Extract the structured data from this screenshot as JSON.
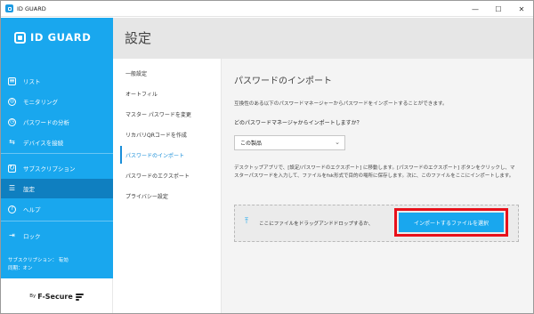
{
  "window": {
    "title": "ID GUARD",
    "controls": [
      "—",
      "☐",
      "✕"
    ]
  },
  "brand": {
    "name": "ID GUARD",
    "footer_by": "By",
    "footer_brand": "F-Secure"
  },
  "colors": {
    "sidebar": "#19a7ee",
    "sidebar_active": "#0f7fc0",
    "accent": "#1a8fd9",
    "highlight_box": "#e8101a"
  },
  "sidebar": {
    "items": [
      {
        "label": "リスト",
        "icon": "list-icon"
      },
      {
        "label": "モニタリング",
        "icon": "monitoring-icon"
      },
      {
        "label": "パスワードの分析",
        "icon": "clock-icon"
      },
      {
        "label": "デバイスを接続",
        "icon": "connect-device-icon"
      },
      {
        "label": "サブスクリプション",
        "icon": "subscription-icon"
      },
      {
        "label": "設定",
        "icon": "settings-sliders-icon",
        "active": true
      },
      {
        "label": "ヘルプ",
        "icon": "help-icon"
      },
      {
        "label": "ロック",
        "icon": "lock-icon"
      }
    ],
    "status_line1": "サブスクリプション： 有効",
    "status_line2": "同期：オン"
  },
  "page": {
    "title": "設定"
  },
  "settings_menu": {
    "items": [
      {
        "label": "一般設定"
      },
      {
        "label": "オートフィル"
      },
      {
        "label": "マスター パスワードを変更"
      },
      {
        "label": "リカバリQRコードを作成"
      },
      {
        "label": "パスワードのインポート",
        "active": true
      },
      {
        "label": "パスワードのエクスポート"
      },
      {
        "label": "プライバシー設定"
      }
    ]
  },
  "import": {
    "title": "パスワードのインポート",
    "description": "互換性のある以下のパスワードマネージャーからパスワードをインポートすることができます。",
    "question": "どのパスワードマネージャからインポートしますか？",
    "dropdown_value": "この製品",
    "instructions": "デスクトップアプリで、[設定/パスワードのエクスポート] に移動します。[パスワードのエクスポート] ボタンをクリックし、マスターパスワードを入力して、ファイルをfsk形式で目的の場所に保存します。次に、このファイルをここにインポートします。",
    "dropzone_text": "ここにファイルをドラッグアンドドロップするか、",
    "button_label": "インポートするファイルを選択"
  }
}
